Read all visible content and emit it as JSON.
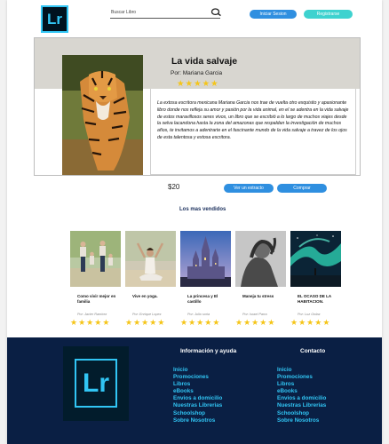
{
  "header": {
    "logo_text": "Lr",
    "search_placeholder": "Buscar Libro",
    "login_label": "Iniciar Sesion",
    "register_label": "Registrarse"
  },
  "hero": {
    "title": "La vida salvaje",
    "author": "Por: Mariana Garcia",
    "rating": 5,
    "description": "La extosa escritora mexicana Mariana Garcia nos trae de vuelta otro exquisito y apasionante libro donde nos refleja su amor y pasión por la  vida animal, en el se adentra en la vida salvaje de estos maravillosos seres vivos, un libro que se escribió a lo largo de muchos viajes desde la selva lacandona hasta la zona del  amazonas que respaldan  la investigación de muchos años, te invitamos a adentrarte en el fascinante mundo de la vida salvaje a travez de los ojos de esta talentosa y extosa escritora.",
    "price": "$20",
    "sample_label": "Ver un extracto",
    "buy_label": "Comprar"
  },
  "bestsellers": {
    "heading": "Los mas vendidos",
    "books": [
      {
        "title": "Como vivir mejor en familia",
        "author": "Por: Javier Ramirez",
        "rating": 5
      },
      {
        "title": "Vive en yoga.",
        "author": "Por: Enrique Lopez",
        "rating": 5
      },
      {
        "title": "La princesa y El castillo",
        "author": "Por: Julio soria",
        "rating": 5
      },
      {
        "title": "Maneja tu stress",
        "author": "Por: Israel Parra",
        "rating": 5
      },
      {
        "title": "EL OCASO DE LA HABITACION.",
        "author": "Por: Luz Ordaz",
        "rating": 5
      }
    ]
  },
  "footer": {
    "logo_text": "Lr",
    "info_heading": "Información y ayuda",
    "contact_heading": "Contacto",
    "links": [
      "Inicio",
      "Promociones",
      "Libros",
      "eBooks",
      "Envios a domicilio",
      "Nuestras Librerias",
      "Schoolshop",
      "Sobre Nosotros"
    ],
    "contact_links": [
      "Inicio",
      "Promociones",
      "Libros",
      "eBooks",
      "Envios a domicilio",
      "Nuestras Librerias",
      "Schoolshop",
      "Sobre Nosotros"
    ]
  },
  "colors": {
    "brand_blue": "#2f8fe0",
    "brand_teal": "#3ed2cf",
    "footer_bg": "#0a1f44",
    "footer_link": "#31c5f4",
    "star": "#f5c518"
  }
}
